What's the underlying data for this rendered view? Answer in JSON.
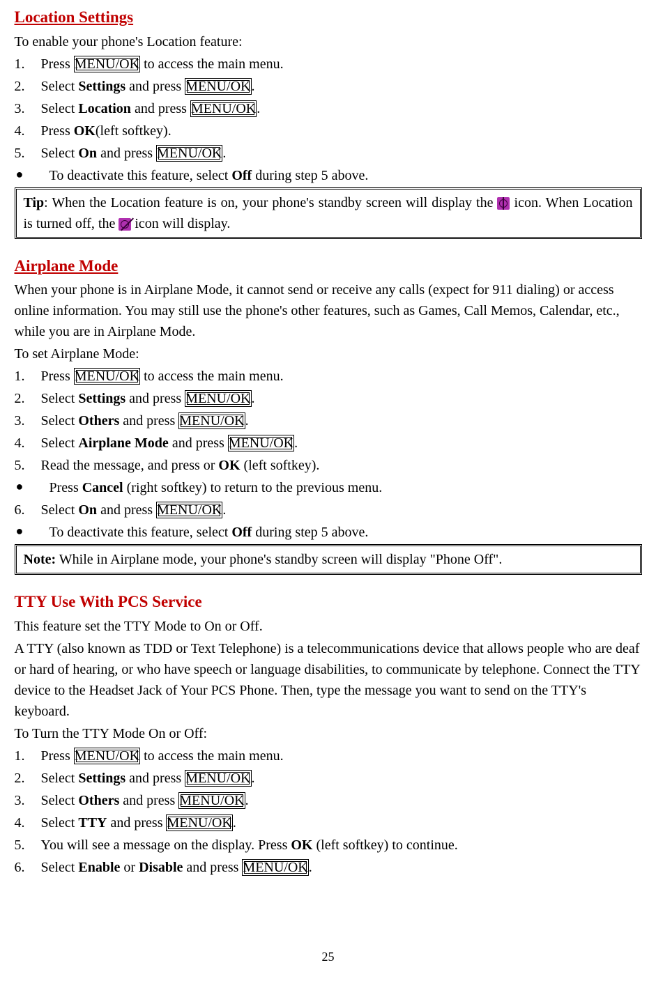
{
  "page_number": "25",
  "location": {
    "title": "Location Settings",
    "intro": "To enable your phone's Location feature:",
    "steps": {
      "1_pre": "Press ",
      "1_box": "MENU/OK",
      "1_post": " to access the main menu.",
      "2_pre": "Select ",
      "2_bold": "Settings",
      "2_mid": " and press ",
      "2_box": "MENU/OK",
      "2_post": ".",
      "3_pre": "Select ",
      "3_bold": "Location",
      "3_mid": " and press ",
      "3_box": "MENU/OK",
      "3_post": ".",
      "4_pre": "Press ",
      "4_bold": "OK",
      "4_post": "(left softkey).",
      "5_pre": "Select ",
      "5_bold": "On",
      "5_mid": " and press ",
      "5_box": "MENU/OK",
      "5_post": "."
    },
    "bullet_pre": "To deactivate this feature, select ",
    "bullet_bold": "Off",
    "bullet_post": " during step 5 above.",
    "tip_label": "Tip",
    "tip_1": ": When the Location feature is on, your phone's standby screen will display the ",
    "tip_2": " icon. When Location is turned off, the ",
    "tip_3": " icon will display."
  },
  "airplane": {
    "title": "Airplane Mode",
    "para": "When your phone is in Airplane Mode, it cannot send or receive any calls (expect for 911 dialing) or access online information. You may still use the phone's other features, such as Games, Call Memos, Calendar, etc., while you are in Airplane Mode.",
    "intro": "To set Airplane Mode:",
    "steps": {
      "1_pre": "Press ",
      "1_box": "MENU/OK",
      "1_post": " to access the main menu.",
      "2_pre": "Select ",
      "2_bold": "Settings",
      "2_mid": " and press ",
      "2_box": "MENU/OK",
      "2_post": ".",
      "3_pre": "Select ",
      "3_bold": "Others",
      "3_mid": " and press ",
      "3_box": "MENU/OK",
      "3_post": ".",
      "4_pre": "Select ",
      "4_bold": "Airplane Mode",
      "4_mid": " and press ",
      "4_box": "MENU/OK",
      "4_post": ".",
      "5_pre": "Read the message, and press or ",
      "5_bold": "OK",
      "5_post": " (left softkey).",
      "6_pre": "Select ",
      "6_bold": "On",
      "6_mid": " and press ",
      "6_box": "MENU/OK",
      "6_post": "."
    },
    "bullet1_pre": "Press ",
    "bullet1_bold": "Cancel",
    "bullet1_post": " (right softkey) to return to the previous menu.",
    "bullet2_pre": "To deactivate this feature, select ",
    "bullet2_bold": "Off",
    "bullet2_post": " during step 5 above.",
    "note_label": "Note:",
    "note_text": " While in Airplane mode, your phone's standby screen will display \"Phone Off\"."
  },
  "tty": {
    "title": "TTY Use With PCS Service",
    "para1": "This feature set the TTY Mode to On or Off.",
    "para2": "A TTY (also known as TDD or Text Telephone) is a telecommunications device that allows people who are deaf or hard of hearing, or who have speech or language disabilities, to communicate by telephone. Connect the TTY device to the Headset Jack of Your PCS Phone. Then, type the message you want to send on the TTY's keyboard.",
    "intro": "To Turn the TTY Mode On or Off:",
    "steps": {
      "1_pre": "Press ",
      "1_box": "MENU/OK",
      "1_post": " to access the main menu.",
      "2_pre": "Select ",
      "2_bold": "Settings",
      "2_mid": " and press ",
      "2_box": "MENU/OK",
      "2_post": ".",
      "3_pre": "Select ",
      "3_bold": "Others",
      "3_mid": " and press ",
      "3_box": "MENU/OK",
      "3_post": ".",
      "4_pre": "Select ",
      "4_bold": "TTY",
      "4_mid": " and press ",
      "4_box": "MENU/OK",
      "4_post": ".",
      "5_pre": "You will see a message on the display. Press ",
      "5_bold": "OK",
      "5_post": " (left softkey) to continue.",
      "6_pre": "Select ",
      "6_bold1": "Enable",
      "6_mid1": " or ",
      "6_bold2": "Disable",
      "6_mid2": " and press ",
      "6_box": "MENU/OK",
      "6_post": "."
    }
  }
}
